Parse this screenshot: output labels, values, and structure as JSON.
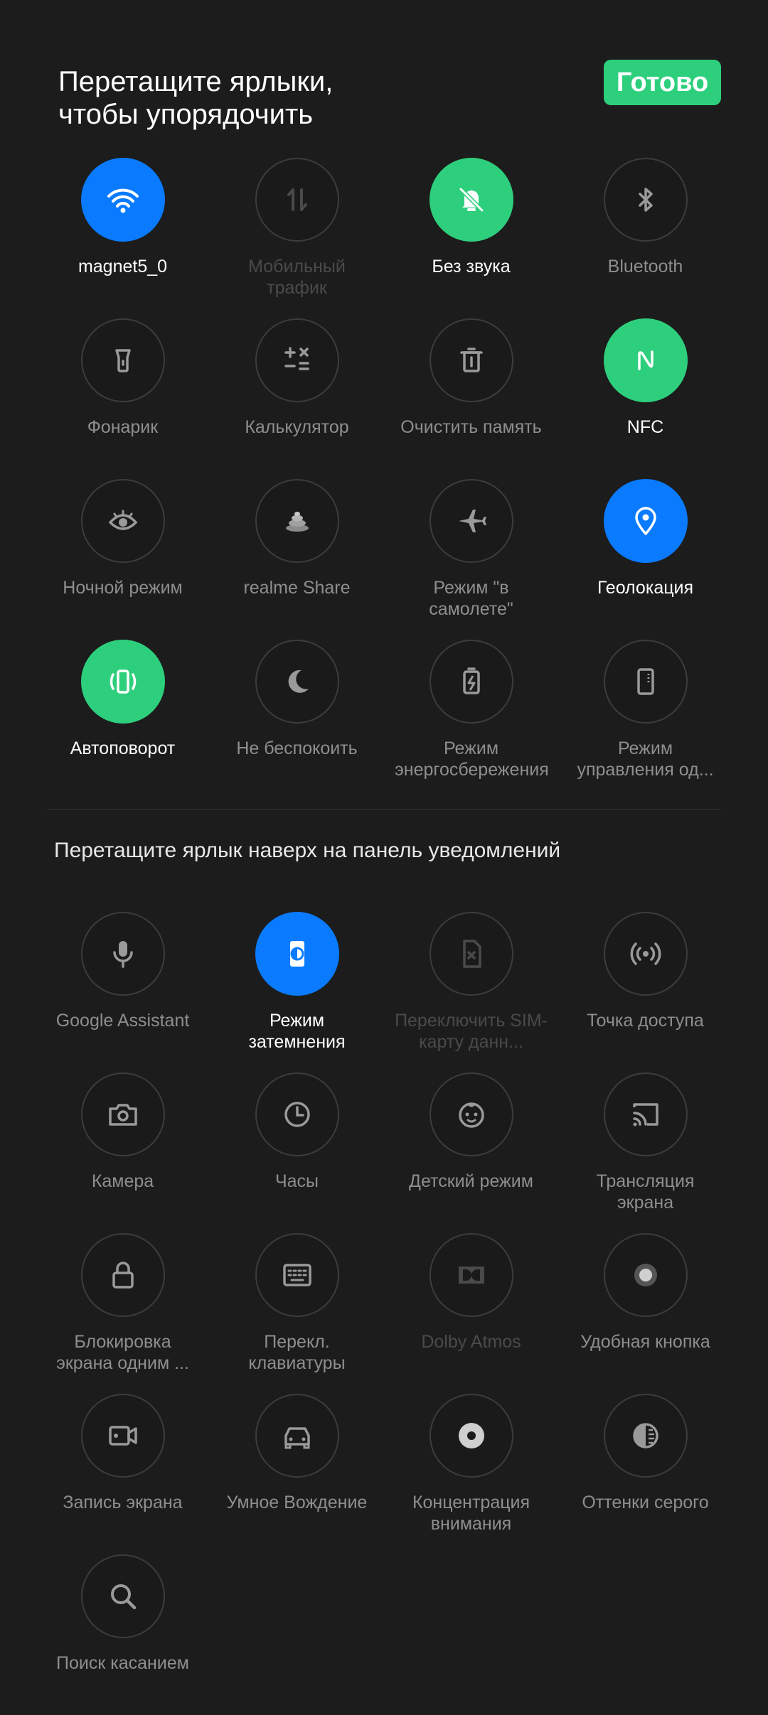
{
  "header": {
    "title": "Перетащите ярлыки,\nчтобы упорядочить",
    "done_label": "Готово"
  },
  "active_tiles": [
    {
      "label": "magnet5_0",
      "icon": "wifi-icon",
      "state": "on-blue"
    },
    {
      "label": "Мобильный трафик",
      "icon": "mobile-data-icon",
      "state": "disabled"
    },
    {
      "label": "Без звука",
      "icon": "bell-off-icon",
      "state": "on-green"
    },
    {
      "label": "Bluetooth",
      "icon": "bluetooth-icon",
      "state": "off"
    },
    {
      "label": "Фонарик",
      "icon": "flashlight-icon",
      "state": "off"
    },
    {
      "label": "Калькулятор",
      "icon": "calculator-icon",
      "state": "off"
    },
    {
      "label": "Очистить память",
      "icon": "trash-icon",
      "state": "off"
    },
    {
      "label": "NFC",
      "icon": "nfc-icon",
      "state": "on-green"
    },
    {
      "label": "Ночной режим",
      "icon": "eye-icon",
      "state": "off"
    },
    {
      "label": "realme Share",
      "icon": "realme-share-icon",
      "state": "off"
    },
    {
      "label": "Режим \"в самолете\"",
      "icon": "airplane-icon",
      "state": "off"
    },
    {
      "label": "Геолокация",
      "icon": "location-icon",
      "state": "on-blue"
    },
    {
      "label": "Автоповорот",
      "icon": "rotate-icon",
      "state": "on-green"
    },
    {
      "label": "Не беспокоить",
      "icon": "moon-icon",
      "state": "off"
    },
    {
      "label": "Режим энергосбережения",
      "icon": "battery-saver-icon",
      "state": "off"
    },
    {
      "label": "Режим управления од...",
      "icon": "one-hand-icon",
      "state": "off"
    }
  ],
  "section": {
    "title": "Перетащите ярлык наверх на панель уведомлений"
  },
  "available_tiles": [
    {
      "label": "Google Assistant",
      "icon": "microphone-icon",
      "state": "off"
    },
    {
      "label": "Режим затемнения",
      "icon": "dark-mode-icon",
      "state": "on-blue"
    },
    {
      "label": "Переключить SIM-карту данн...",
      "icon": "sim-icon",
      "state": "disabled"
    },
    {
      "label": "Точка доступа",
      "icon": "hotspot-icon",
      "state": "off"
    },
    {
      "label": "Камера",
      "icon": "camera-icon",
      "state": "off"
    },
    {
      "label": "Часы",
      "icon": "clock-icon",
      "state": "off"
    },
    {
      "label": "Детский режим",
      "icon": "kid-icon",
      "state": "off"
    },
    {
      "label": "Трансляция экрана",
      "icon": "cast-icon",
      "state": "off"
    },
    {
      "label": "Блокировка экрана одним ...",
      "icon": "lock-icon",
      "state": "off"
    },
    {
      "label": "Перекл. клавиатуры",
      "icon": "keyboard-icon",
      "state": "off"
    },
    {
      "label": "Dolby Atmos",
      "icon": "dolby-icon",
      "state": "disabled"
    },
    {
      "label": "Удобная кнопка",
      "icon": "assistive-button-icon",
      "state": "off"
    },
    {
      "label": "Запись экрана",
      "icon": "screen-record-icon",
      "state": "off"
    },
    {
      "label": "Умное Вождение",
      "icon": "car-icon",
      "state": "off"
    },
    {
      "label": "Концентрация внимания",
      "icon": "focus-icon",
      "state": "off"
    },
    {
      "label": "Оттенки серого",
      "icon": "grayscale-icon",
      "state": "off"
    },
    {
      "label": "Поиск касанием",
      "icon": "search-icon",
      "state": "off"
    }
  ],
  "colors": {
    "accent_blue": "#0a7bff",
    "accent_green": "#2ecf7c",
    "background": "#1c1c1c"
  }
}
